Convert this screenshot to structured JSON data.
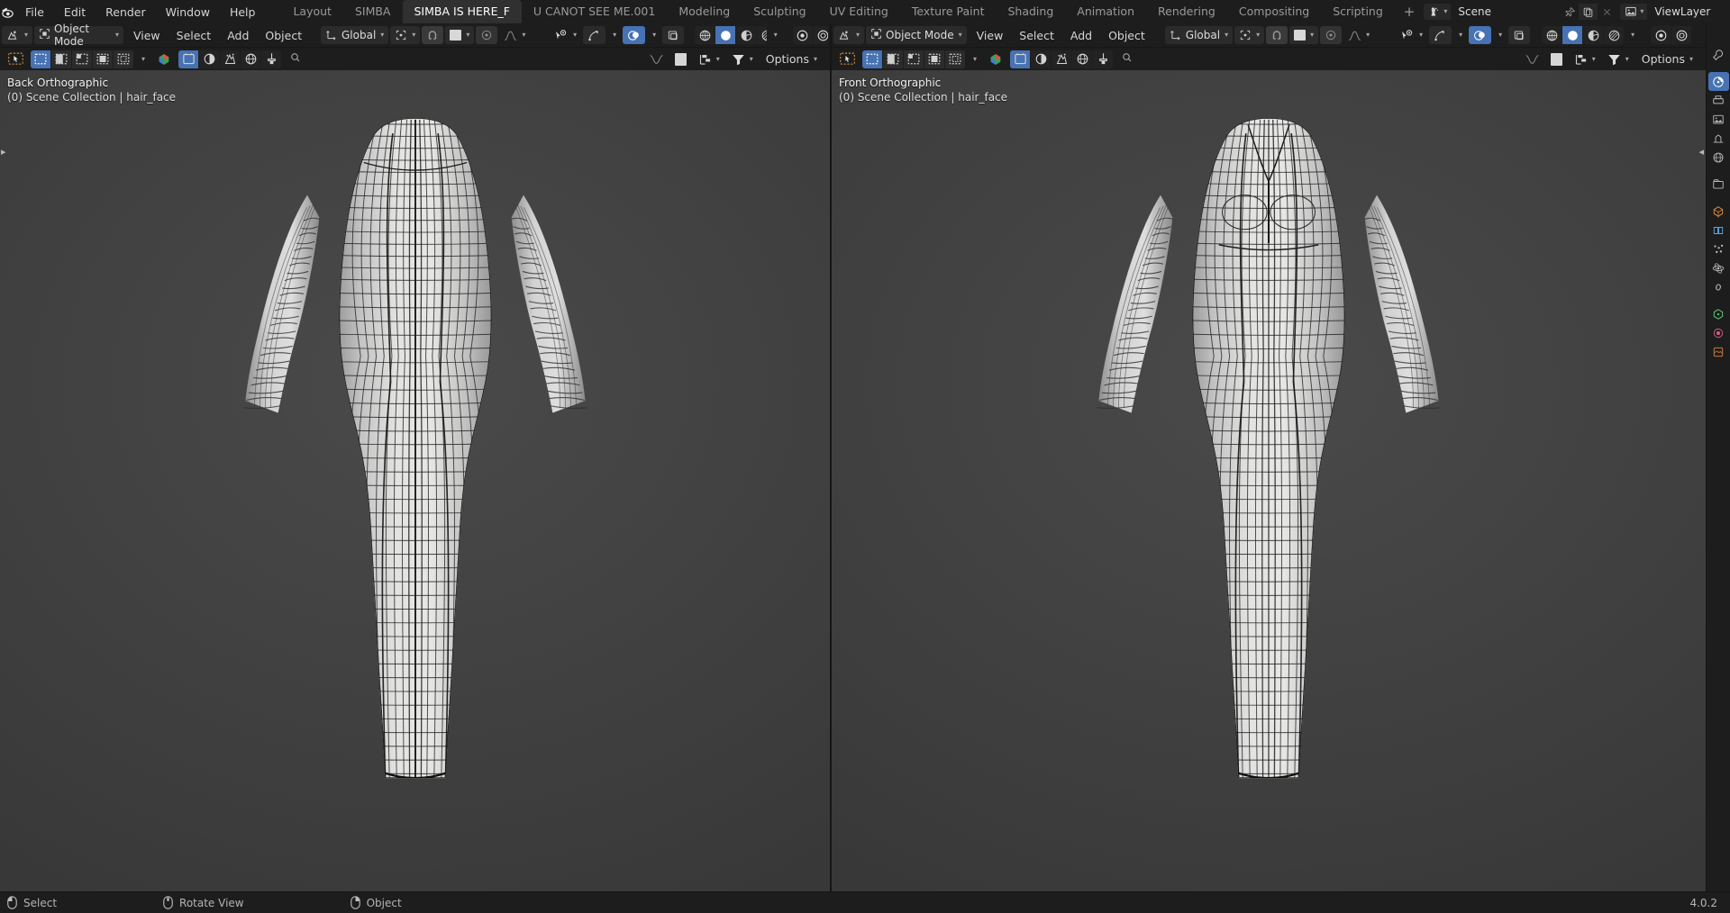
{
  "app": {
    "version": "4.0.2",
    "accent": "#4772b3",
    "header_bg": "#1d1d1d",
    "viewport_bg": "#3b3b3b"
  },
  "topbar": {
    "logo_icon": "blender-logo-icon",
    "menus": [
      "File",
      "Edit",
      "Render",
      "Window",
      "Help"
    ],
    "workspaces": [
      {
        "label": "Layout",
        "active": false
      },
      {
        "label": "SIMBA",
        "active": false
      },
      {
        "label": "SIMBA IS HERE_F",
        "active": true
      },
      {
        "label": "U CANOT SEE ME.001",
        "active": false
      },
      {
        "label": "Modeling",
        "active": false
      },
      {
        "label": "Sculpting",
        "active": false
      },
      {
        "label": "UV Editing",
        "active": false
      },
      {
        "label": "Texture Paint",
        "active": false
      },
      {
        "label": "Shading",
        "active": false
      },
      {
        "label": "Animation",
        "active": false
      },
      {
        "label": "Rendering",
        "active": false
      },
      {
        "label": "Compositing",
        "active": false
      },
      {
        "label": "Scripting",
        "active": false
      }
    ],
    "add_workspace_label": "+",
    "scene": {
      "icon": "scene-icon",
      "name": "Scene",
      "pin_icon": "pin-icon",
      "copy_icon": "new-scene-icon",
      "close_icon": "unlink-icon"
    },
    "viewlayer": {
      "icon": "viewlayer-icon",
      "name": "ViewLayer",
      "copy_icon": "new-viewlayer-icon",
      "close_icon": "remove-viewlayer-icon"
    }
  },
  "editors": [
    {
      "id": "left",
      "header": {
        "editor_type_icon": "editor-type-3dview-icon",
        "mode": "Object Mode",
        "mode_icon": "object-mode-icon",
        "menus": [
          "View",
          "Select",
          "Add",
          "Object"
        ],
        "transform_orientation": "Global",
        "transform_orientation_icon": "orientation-gizmo-icon",
        "pivot_icon": "pivot-point-icon",
        "snap_icon": "magnet-icon",
        "snap_target_icon": "snap-increment-icon",
        "proportional_icon": "proportional-edit-icon",
        "proportional_falloff_icon": "falloff-curve-icon",
        "visibility_icon": "show-gizmo-visibility-icon",
        "gizmo_icon": "gizmo-icon",
        "overlays_icon": "overlays-icon",
        "overlays_active": true,
        "xray_icon": "toggle-xray-icon",
        "shading_modes": [
          {
            "name": "wireframe-shading-icon",
            "active": false
          },
          {
            "name": "solid-shading-icon",
            "active": true
          },
          {
            "name": "material-preview-shading-icon",
            "active": false
          },
          {
            "name": "rendered-shading-icon",
            "active": false
          }
        ],
        "viewport_shading_dropdown_icon": "chevron-down-icon",
        "render_preview_icons": [
          "viewport-render-icon",
          "viewport-render-region-icon"
        ]
      },
      "tools": {
        "tool_icon": "tweak-tool-icon",
        "select_modes": [
          {
            "name": "select-box-icon",
            "active": true
          },
          {
            "name": "select-extend-icon",
            "active": false
          },
          {
            "name": "select-subtract-icon",
            "active": false
          },
          {
            "name": "select-invert-icon",
            "active": false
          },
          {
            "name": "select-intersect-icon",
            "active": false
          }
        ],
        "mode_dropdown_icon": "chevron-down-icon",
        "material_icon": "material-preview-icon",
        "object_type_icons": [
          "object-origin-icon",
          "shading-icon",
          "particles-icon",
          "world-icon",
          "brush-icon"
        ],
        "search_icon": "search-icon",
        "search_value": "",
        "filter_icons": [
          "falloff-icon",
          "color-swatch-icon",
          "snap-pivot-icon",
          "filter-funnel-icon"
        ],
        "options_label": "Options"
      },
      "overlay": {
        "view_name": "Back Orthographic",
        "collection_line": "(0) Scene Collection | hair_face"
      },
      "model": {
        "name": "hair_face",
        "orientation": "back"
      }
    },
    {
      "id": "right",
      "header": {
        "editor_type_icon": "editor-type-3dview-icon",
        "mode": "Object Mode",
        "mode_icon": "object-mode-icon",
        "menus": [
          "View",
          "Select",
          "Add",
          "Object"
        ],
        "transform_orientation": "Global",
        "transform_orientation_icon": "orientation-gizmo-icon",
        "pivot_icon": "pivot-point-icon",
        "snap_icon": "magnet-icon",
        "snap_target_icon": "snap-increment-icon",
        "proportional_icon": "proportional-edit-icon",
        "proportional_falloff_icon": "falloff-curve-icon",
        "visibility_icon": "show-gizmo-visibility-icon",
        "gizmo_icon": "gizmo-icon",
        "overlays_icon": "overlays-icon",
        "overlays_active": true,
        "xray_icon": "toggle-xray-icon",
        "shading_modes": [
          {
            "name": "wireframe-shading-icon",
            "active": false
          },
          {
            "name": "solid-shading-icon",
            "active": true
          },
          {
            "name": "material-preview-shading-icon",
            "active": false
          },
          {
            "name": "rendered-shading-icon",
            "active": false
          }
        ],
        "viewport_shading_dropdown_icon": "chevron-down-icon",
        "render_preview_icons": [
          "viewport-render-icon",
          "viewport-render-region-icon"
        ]
      },
      "tools": {
        "tool_icon": "tweak-tool-icon",
        "select_modes": [
          {
            "name": "select-box-icon",
            "active": true
          },
          {
            "name": "select-extend-icon",
            "active": false
          },
          {
            "name": "select-subtract-icon",
            "active": false
          },
          {
            "name": "select-invert-icon",
            "active": false
          },
          {
            "name": "select-intersect-icon",
            "active": false
          }
        ],
        "mode_dropdown_icon": "chevron-down-icon",
        "material_icon": "material-preview-icon",
        "object_type_icons": [
          "object-origin-icon",
          "shading-icon",
          "particles-icon",
          "world-icon",
          "brush-icon"
        ],
        "search_icon": "search-icon",
        "search_value": "",
        "filter_icons": [
          "falloff-icon",
          "color-swatch-icon",
          "snap-pivot-icon",
          "filter-funnel-icon"
        ],
        "options_label": "Options"
      },
      "overlay": {
        "view_name": "Front Orthographic",
        "collection_line": "(0) Scene Collection | hair_face"
      },
      "model": {
        "name": "hair_face",
        "orientation": "front"
      }
    }
  ],
  "rightbar": {
    "icons": [
      {
        "name": "tool-properties-icon",
        "active": false
      },
      {
        "name": "render-properties-icon",
        "active": true
      },
      {
        "name": "output-properties-icon",
        "active": false
      },
      {
        "name": "view-layer-properties-icon",
        "active": false
      },
      {
        "name": "scene-properties-icon",
        "active": false
      },
      {
        "name": "world-properties-icon",
        "active": false
      },
      {
        "name": "collection-properties-icon",
        "active": false
      },
      {
        "name": "object-properties-icon",
        "active": false
      },
      {
        "name": "modifier-properties-icon",
        "active": false
      },
      {
        "name": "particle-properties-icon",
        "active": false
      },
      {
        "name": "physics-properties-icon",
        "active": false
      },
      {
        "name": "constraint-properties-icon",
        "active": false
      },
      {
        "name": "data-properties-icon",
        "active": false
      },
      {
        "name": "material-properties-icon",
        "active": false
      },
      {
        "name": "texture-properties-icon",
        "active": false
      }
    ]
  },
  "statusbar": {
    "items": [
      {
        "icon": "mouse-left-icon",
        "label": "Select"
      },
      {
        "icon": "mouse-middle-icon",
        "label": "Rotate View"
      },
      {
        "icon": "mouse-right-icon",
        "label": "Object"
      }
    ],
    "version_label": "4.0.2"
  }
}
